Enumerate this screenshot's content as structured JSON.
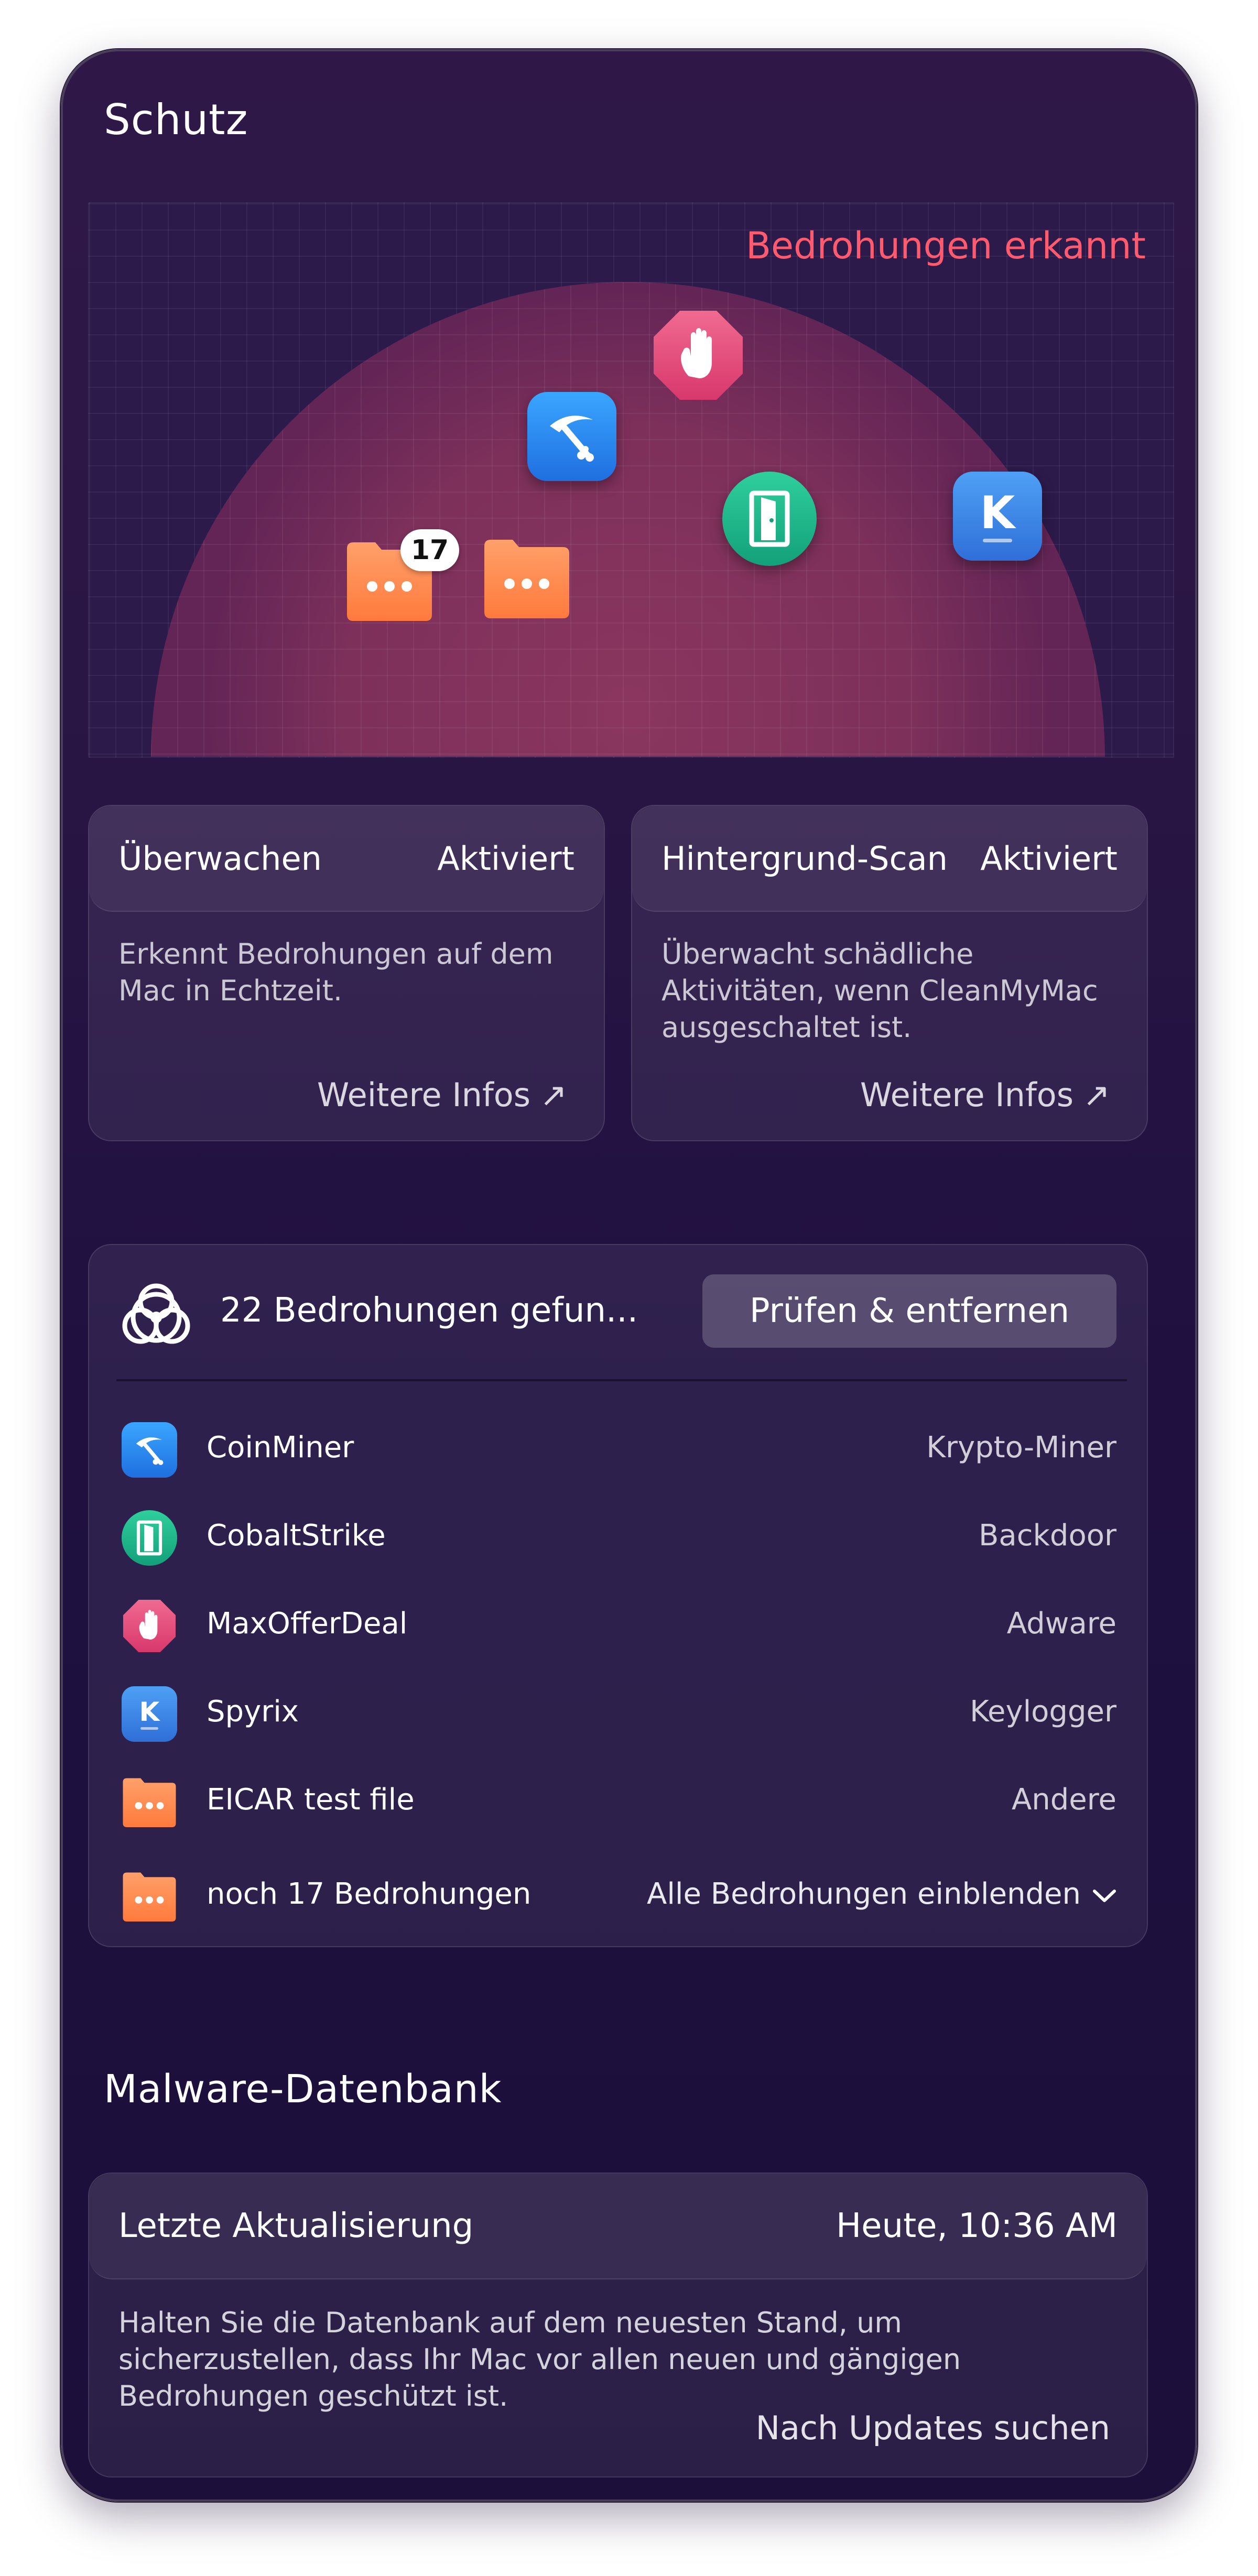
{
  "protection": {
    "title": "Schutz",
    "radar_status": "Bedrohungen erkannt",
    "badge_count": "17"
  },
  "monitor": {
    "title": "Überwachen",
    "status": "Aktiviert",
    "description": "Erkennt Bedrohungen auf dem Mac in Echtzeit.",
    "link": "Weitere Infos"
  },
  "background_scan": {
    "title": "Hintergrund-Scan",
    "status": "Aktiviert",
    "description": "Überwacht schädliche Aktivitäten, wenn CleanMyMac ausgeschaltet ist.",
    "link": "Weitere Infos"
  },
  "threats": {
    "summary": "22 Bedrohungen gefun...",
    "review_button": "Prüfen & entfernen",
    "items": [
      {
        "name": "CoinMiner",
        "type": "Krypto-Miner",
        "icon": "pickaxe-icon"
      },
      {
        "name": "CobaltStrike",
        "type": "Backdoor",
        "icon": "door-icon"
      },
      {
        "name": "MaxOfferDeal",
        "type": "Adware",
        "icon": "hand-stop-icon"
      },
      {
        "name": "Spyrix",
        "type": "Keylogger",
        "icon": "keyboard-k-icon"
      },
      {
        "name": "EICAR test file",
        "type": "Andere",
        "icon": "folder-icon"
      }
    ],
    "more_label": "noch 17 Bedrohungen",
    "show_all": "Alle Bedrohungen einblenden"
  },
  "malware_db": {
    "title": "Malware-Datenbank",
    "last_update_label": "Letzte Aktualisierung",
    "last_update_value": "Heute, 10:36 AM",
    "description": "Halten Sie die Datenbank auf dem neuesten Stand, um sicherzustellen, dass Ihr Mac vor allen neuen und gängigen Bedrohungen geschützt ist.",
    "check_updates": "Nach Updates suchen"
  },
  "colors": {
    "threat_red": "#ff5a6e",
    "coinminer_blue": "#2d8ff0",
    "cobalt_green": "#1fb98a",
    "adware_pink": "#e0457a",
    "spyrix_blue": "#3a8bea",
    "folder_orange": "#ff8a4c"
  }
}
